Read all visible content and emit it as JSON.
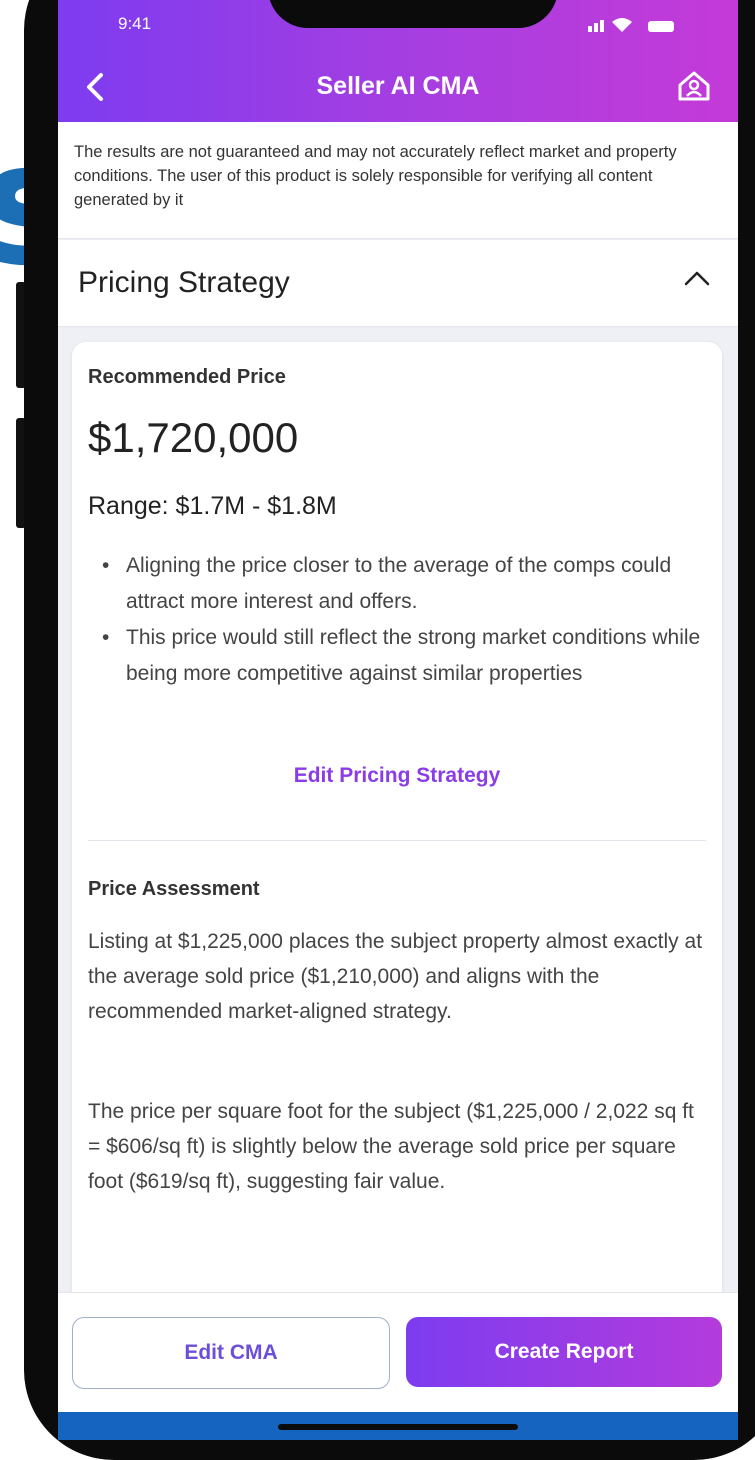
{
  "status_bar": {
    "time": "9:41"
  },
  "header": {
    "title": "Seller AI CMA"
  },
  "disclaimer": "The results are not guaranteed and may not accurately reflect market and property conditions. The user of this product is solely responsible for verifying all content generated by it",
  "section": {
    "title": "Pricing Strategy"
  },
  "pricing": {
    "recommended_label": "Recommended Price",
    "price": "$1,720,000",
    "range": "Range: $1.7M - $1.8M",
    "bullets": [
      "Aligning the price closer to the average of the comps could attract more interest and offers.",
      "This price would still reflect the strong market conditions while being more competitive against similar properties"
    ],
    "edit_link": "Edit Pricing Strategy"
  },
  "assessment": {
    "label": "Price Assessment",
    "paragraphs": [
      "Listing at $1,225,000 places the subject property almost exactly at the average sold price ($1,210,000) and aligns with the recommended market-aligned strategy.",
      "The price per square foot for the subject ($1,225,000 / 2,022 sq ft = $606/sq ft) is slightly below the average sold price per square foot ($619/sq ft), suggesting fair value."
    ]
  },
  "actions": {
    "edit_cma": "Edit CMA",
    "create_report": "Create Report"
  },
  "background": {
    "partial_letter": "s"
  },
  "colors": {
    "accent_start": "#7d3cf0",
    "accent_end": "#c43ad8",
    "link": "#8a3de6"
  }
}
